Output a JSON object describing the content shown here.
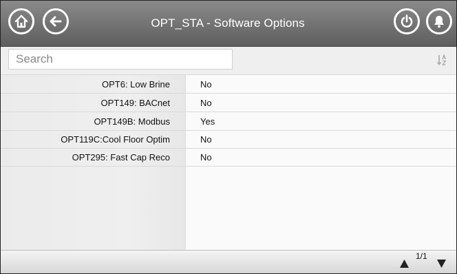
{
  "header": {
    "title": "OPT_STA - Software Options",
    "icons": [
      "home-icon",
      "back-arrow-icon",
      "power-icon",
      "bell-icon"
    ]
  },
  "search": {
    "placeholder": "Search",
    "value": ""
  },
  "table": {
    "rows": [
      {
        "name": "OPT6: Low Brine",
        "value": "No"
      },
      {
        "name": "OPT149: BACnet",
        "value": "No"
      },
      {
        "name": "OPT149B: Modbus",
        "value": "Yes"
      },
      {
        "name": "OPT119C:Cool Floor Optim",
        "value": "No"
      },
      {
        "name": "OPT295: Fast Cap Reco",
        "value": "No"
      }
    ]
  },
  "footer": {
    "page": "1/1"
  },
  "colors": {
    "header_gradient_top": "#8a8a8a",
    "header_gradient_bottom": "#5e5e5e"
  }
}
